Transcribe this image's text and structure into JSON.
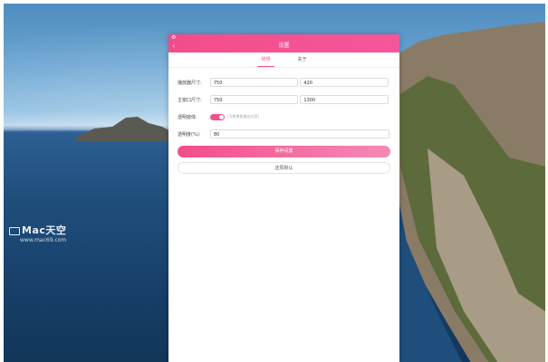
{
  "watermark": {
    "main": "Mac天空",
    "sub": "www.mac69.com"
  },
  "window": {
    "title": "设置",
    "tabs": [
      {
        "label": "常规",
        "active": true
      },
      {
        "label": "关于",
        "active": false
      }
    ],
    "fields": {
      "player_size": {
        "label": "播放器尺寸:",
        "width": "750",
        "height": "420"
      },
      "window_size": {
        "label": "主窗口尺寸:",
        "width": "750",
        "height": "1300"
      },
      "transparent": {
        "label": "透明窗体:",
        "enabled": true,
        "hint": "(可能需要重启应用)"
      },
      "opacity": {
        "label": "透明度(%):",
        "value": "80"
      }
    },
    "buttons": {
      "save": "保存设置",
      "reset": "还原默认"
    }
  },
  "colors": {
    "accent": "#f2508f"
  }
}
